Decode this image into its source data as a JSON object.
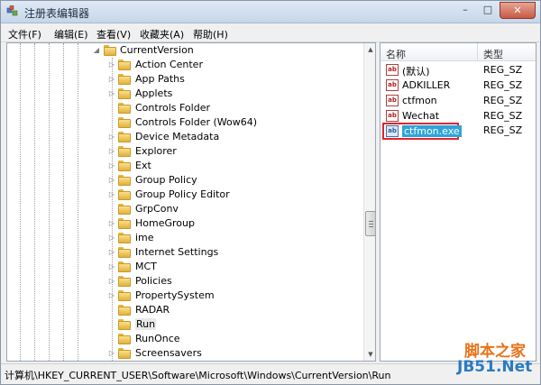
{
  "window": {
    "title": "注册表编辑器"
  },
  "title_buttons": {
    "minimize": "–",
    "maximize": "□",
    "close": "✕"
  },
  "menu": [
    {
      "label": "文件(F)"
    },
    {
      "label": "编辑(E)"
    },
    {
      "label": "查看(V)"
    },
    {
      "label": "收藏夹(A)"
    },
    {
      "label": "帮助(H)"
    }
  ],
  "tree": {
    "parent": {
      "label": "CurrentVersion"
    },
    "items": [
      {
        "label": "Action Center",
        "expandable": true
      },
      {
        "label": "App Paths",
        "expandable": true
      },
      {
        "label": "Applets",
        "expandable": true
      },
      {
        "label": "Controls Folder",
        "expandable": false
      },
      {
        "label": "Controls Folder (Wow64)",
        "expandable": false
      },
      {
        "label": "Device Metadata",
        "expandable": true
      },
      {
        "label": "Explorer",
        "expandable": true
      },
      {
        "label": "Ext",
        "expandable": true
      },
      {
        "label": "Group Policy",
        "expandable": true
      },
      {
        "label": "Group Policy Editor",
        "expandable": true
      },
      {
        "label": "GrpConv",
        "expandable": false
      },
      {
        "label": "HomeGroup",
        "expandable": true
      },
      {
        "label": "ime",
        "expandable": true
      },
      {
        "label": "Internet Settings",
        "expandable": true
      },
      {
        "label": "MCT",
        "expandable": true
      },
      {
        "label": "Policies",
        "expandable": true
      },
      {
        "label": "PropertySystem",
        "expandable": true
      },
      {
        "label": "RADAR",
        "expandable": false
      },
      {
        "label": "Run",
        "expandable": false,
        "selected": true
      },
      {
        "label": "RunOnce",
        "expandable": false
      },
      {
        "label": "Screensavers",
        "expandable": true
      }
    ]
  },
  "values_pane": {
    "columns": {
      "name": "名称",
      "type": "类型"
    },
    "rows": [
      {
        "name": "(默认)",
        "type": "REG_SZ"
      },
      {
        "name": "ADKILLER",
        "type": "REG_SZ"
      },
      {
        "name": "ctfmon",
        "type": "REG_SZ"
      },
      {
        "name": "Wechat",
        "type": "REG_SZ"
      }
    ],
    "editing_row": {
      "name": "ctfmon.exe",
      "type": "REG_SZ"
    },
    "icon_text": "ab"
  },
  "statusbar": {
    "path": "计算机\\HKEY_CURRENT_USER\\Software\\Microsoft\\Windows\\CurrentVersion\\Run"
  },
  "watermark": {
    "top": "脚本之家",
    "bottom": "JB51.Net"
  },
  "colors": {
    "accent_selection": "#2fa4d9",
    "highlight_border": "#e0242c"
  }
}
